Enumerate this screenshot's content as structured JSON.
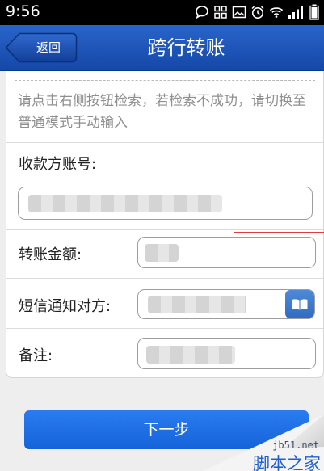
{
  "status_bar": {
    "time": "9:56",
    "icons": [
      "chat-icon",
      "apps-grid-icon",
      "gallery-icon",
      "alarm-icon",
      "wifi-icon",
      "signal-icon",
      "battery-icon"
    ]
  },
  "header": {
    "back_label": "返回",
    "title": "跨行转账",
    "accent": "#1f57b8"
  },
  "form": {
    "hint": "请点击右侧按钮检索，若检索不成功，请切换至普通模式手动输入",
    "account_label": "收款方账号:",
    "account_value": "",
    "amount_label": "转账金额:",
    "amount_value": "",
    "sms_label": "短信通知对方:",
    "sms_value": "",
    "remark_label": "备注:",
    "remark_value": ""
  },
  "next_button": {
    "label": "下一步",
    "color": "#1c6ee6"
  },
  "watermark": {
    "site": "jb51.net",
    "name": "脚本之家"
  }
}
